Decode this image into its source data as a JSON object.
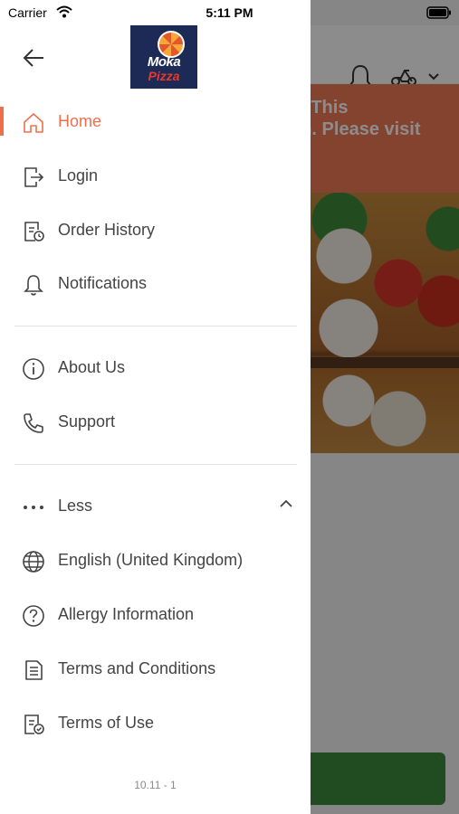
{
  "status_bar": {
    "carrier": "Carrier",
    "time": "5:11 PM"
  },
  "background": {
    "banner_line1": "d, This",
    "banner_line2": "on. Please visit"
  },
  "logo": {
    "line1": "Moka",
    "line2": "Pizza"
  },
  "menu": {
    "home": "Home",
    "login": "Login",
    "order_history": "Order History",
    "notifications": "Notifications",
    "about_us": "About Us",
    "support": "Support",
    "less": "Less",
    "language": "English (United Kingdom)",
    "allergy": "Allergy Information",
    "terms_conditions": "Terms and Conditions",
    "terms_of_use": "Terms of Use"
  },
  "version": "10.11 - 1",
  "colors": {
    "accent": "#ef6f4a",
    "banner": "#f07a56",
    "cta": "#3c8a3e",
    "logo_bg": "#1d2a55"
  },
  "icons": {
    "home": "home-icon",
    "login": "login-icon",
    "order_history": "receipt-clock-icon",
    "notifications": "bell-icon",
    "about_us": "info-icon",
    "support": "phone-icon",
    "less": "more-dots-icon",
    "language": "globe-icon",
    "allergy": "question-icon",
    "terms_conditions": "document-icon",
    "terms_of_use": "document-check-icon"
  }
}
